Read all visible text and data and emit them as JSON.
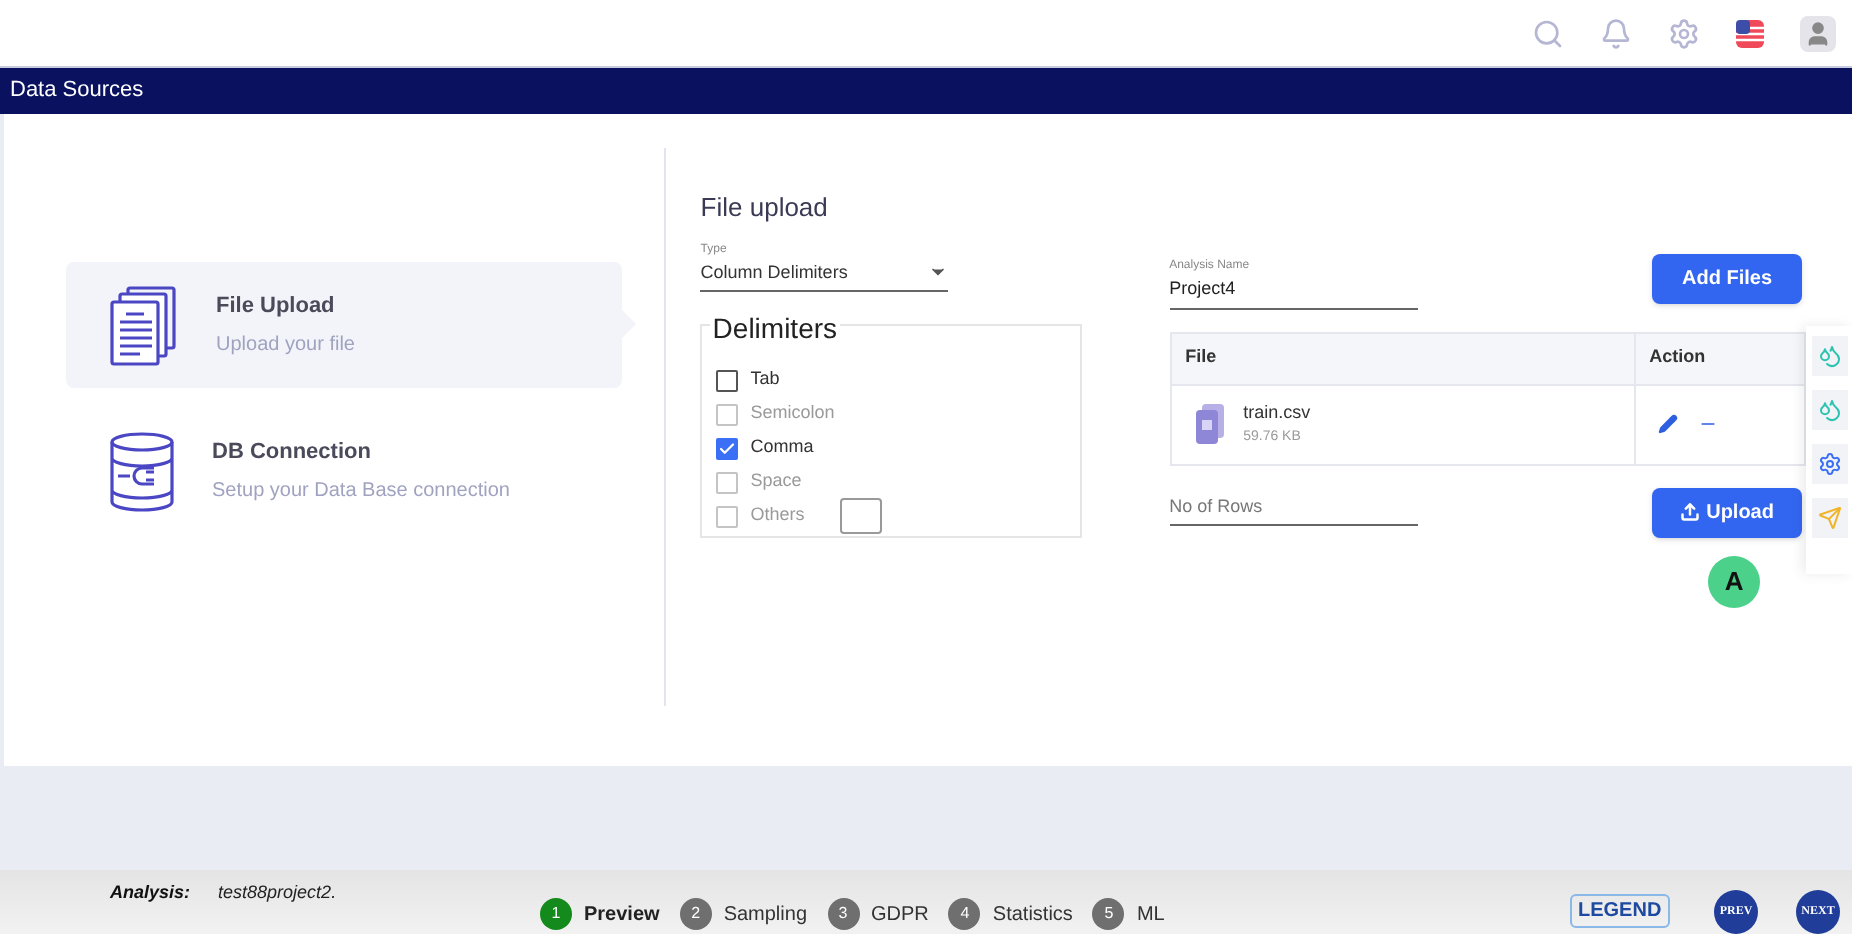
{
  "header": {
    "title": "Data Sources"
  },
  "sources": [
    {
      "title": "File Upload",
      "subtitle": "Upload your file",
      "kind": "file",
      "selected": true
    },
    {
      "title": "DB Connection",
      "subtitle": "Setup your Data Base connection",
      "kind": "db",
      "selected": false
    }
  ],
  "form": {
    "title": "File upload",
    "type_label": "Type",
    "type_value": "Column Delimiters"
  },
  "delimiters": {
    "title": "Delimiters",
    "options": [
      {
        "label": "Tab",
        "checked": false,
        "disabled": false,
        "kind": "plain"
      },
      {
        "label": "Semicolon",
        "checked": false,
        "disabled": true,
        "kind": "plain"
      },
      {
        "label": "Comma",
        "checked": true,
        "disabled": false,
        "kind": "plain"
      },
      {
        "label": "Space",
        "checked": false,
        "disabled": true,
        "kind": "plain"
      },
      {
        "label": "Others",
        "checked": false,
        "disabled": true,
        "kind": "input"
      }
    ]
  },
  "analysis_name": {
    "label": "Analysis Name",
    "value": "Project4"
  },
  "add_files": "Add Files",
  "table": {
    "columns": [
      "File",
      "Action"
    ],
    "rows": [
      {
        "name": "train.csv",
        "size": "59.76 KB"
      }
    ]
  },
  "rows_field": {
    "placeholder": "No of Rows"
  },
  "upload": "Upload",
  "avatar_letter": "A",
  "footer": {
    "label": "Analysis:",
    "value": "test88project2.",
    "steps": [
      {
        "number": "1",
        "label": "Preview",
        "selected": true
      },
      {
        "number": "2",
        "label": "Sampling",
        "selected": false
      },
      {
        "number": "3",
        "label": "GDPR",
        "selected": false
      },
      {
        "number": "4",
        "label": "Statistics",
        "selected": false
      },
      {
        "number": "5",
        "label": "ML",
        "selected": false
      }
    ],
    "legend": "LEGEND",
    "prev": "PREV",
    "next": "NEXT"
  }
}
